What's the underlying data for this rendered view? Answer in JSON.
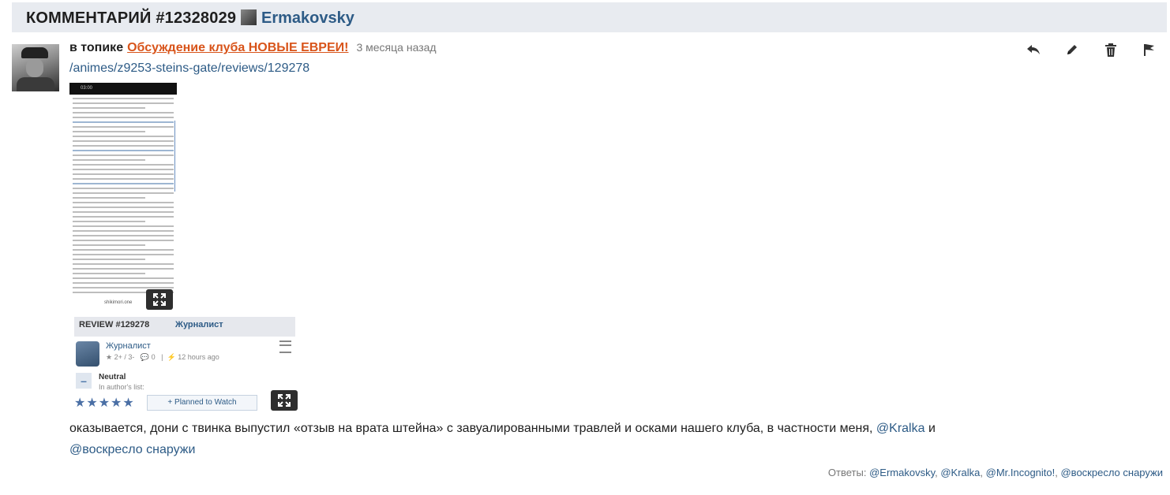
{
  "header": {
    "title": "КОММЕНТАРИЙ #12328029",
    "user": "Ermakovsky"
  },
  "comment": {
    "topic_prefix": "в топике",
    "topic_link": "Обсуждение клуба НОВЫЕ ЕВРЕИ!",
    "time": "3 месяца назад",
    "url": "/animes/z9253-steins-gate/reviews/129278",
    "body_text": "оказывается, дони с твинка выпустил «отзыв на врата штейна» с завуалированными травлей и осками нашего клуба, в частности меня,",
    "mention_kralka": "@Kralka",
    "and_word": "и",
    "mention_chair": "@воскресло снаружи"
  },
  "screenshot1": {
    "status_time": "03:00",
    "footer": "shikimori.one"
  },
  "screenshot2": {
    "review_title": "REVIEW #129278",
    "review_user": "Журналист",
    "author_name": "Журналист",
    "votes": "2+ / 3-",
    "comments": "0",
    "time": "12 hours ago",
    "status": "Neutral",
    "list_label": "In author's list:",
    "stars": "★★★★★",
    "button": "+ Planned to Watch"
  },
  "replies": {
    "label": "Ответы:",
    "items": [
      "@Ermakovsky",
      "@Kralka",
      "@Mr.Incognito!",
      "@воскресло снаружи"
    ]
  },
  "icons": [
    "reply-icon",
    "edit-icon",
    "delete-icon",
    "flag-icon",
    "expand-icon"
  ]
}
